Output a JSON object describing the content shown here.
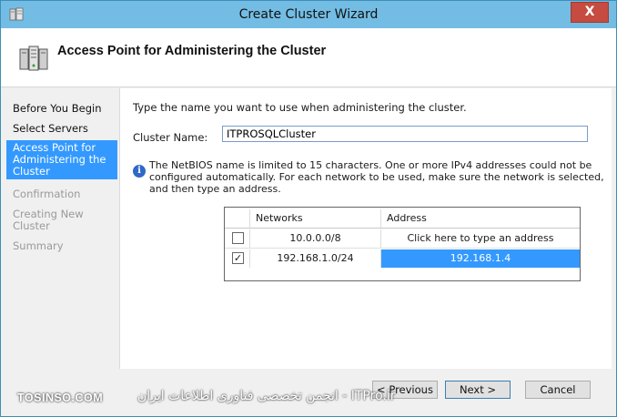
{
  "window": {
    "title": "Create Cluster Wizard",
    "close_glyph": "X"
  },
  "header": {
    "title": "Access Point for Administering the Cluster",
    "icon": "cluster-servers-icon"
  },
  "sidebar": {
    "steps": [
      {
        "label": "Before You Begin",
        "state": "done"
      },
      {
        "label": "Select Servers",
        "state": "done"
      },
      {
        "label": "Access Point for Administering the Cluster",
        "state": "active"
      },
      {
        "label": "Confirmation",
        "state": "disabled"
      },
      {
        "label": "Creating New Cluster",
        "state": "disabled"
      },
      {
        "label": "Summary",
        "state": "disabled"
      }
    ]
  },
  "content": {
    "instruction": "Type the name you want to use when administering the cluster.",
    "cluster_name_label": "Cluster Name:",
    "cluster_name_value": "ITPROSQLCluster",
    "info_text": "The NetBIOS name is limited to 15 characters.  One or more IPv4 addresses could not be configured automatically.  For each network to be used, make sure the network is selected, and then type an address.",
    "table": {
      "headers": {
        "networks": "Networks",
        "address": "Address"
      },
      "rows": [
        {
          "checked": false,
          "network": "10.0.0.0/8",
          "address": "Click here to type an address"
        },
        {
          "checked": true,
          "network": "192.168.1.0/24",
          "address": "192.168.1.4"
        }
      ]
    }
  },
  "buttons": {
    "previous": "< Previous",
    "next": "Next >",
    "cancel": "Cancel"
  },
  "watermark": {
    "left": "TOSINSO.COM",
    "right": "ITPro.ir - انجمن تخصصی فناوری اطلاعات ایران"
  },
  "colors": {
    "titlebar": "#73bde4",
    "selection": "#3399ff",
    "close": "#c64b40"
  }
}
